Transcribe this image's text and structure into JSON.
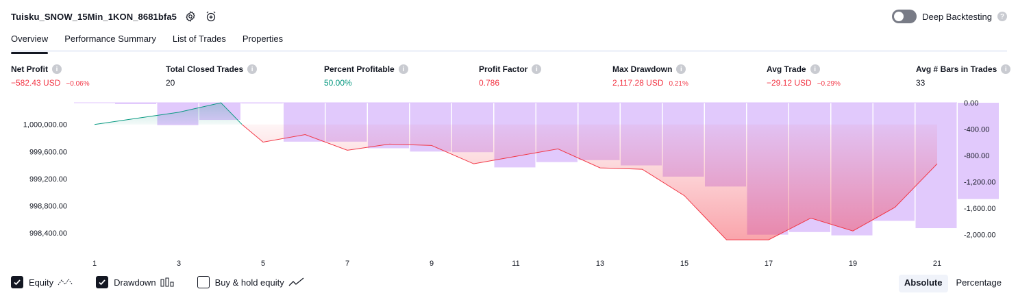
{
  "header": {
    "title": "Tuisku_SNOW_15Min_1KON_8681bfa5",
    "icons": [
      "settings-icon",
      "alarm-add-icon"
    ]
  },
  "deep_backtesting": {
    "label": "Deep Backtesting",
    "enabled": false,
    "help": "?"
  },
  "tabs": [
    {
      "label": "Overview",
      "active": true
    },
    {
      "label": "Performance Summary",
      "active": false
    },
    {
      "label": "List of Trades",
      "active": false
    },
    {
      "label": "Properties",
      "active": false
    }
  ],
  "metrics": {
    "net_profit": {
      "label": "Net Profit",
      "value": "−582.43 USD",
      "pct": "−0.06%"
    },
    "total_closed_trades": {
      "label": "Total Closed Trades",
      "value": "20"
    },
    "percent_profitable": {
      "label": "Percent Profitable",
      "value": "50.00%"
    },
    "profit_factor": {
      "label": "Profit Factor",
      "value": "0.786"
    },
    "max_drawdown": {
      "label": "Max Drawdown",
      "value": "2,117.28 USD",
      "pct": "0.21%"
    },
    "avg_trade": {
      "label": "Avg Trade",
      "value": "−29.12 USD",
      "pct": "−0.29%"
    },
    "avg_bars": {
      "label": "Avg # Bars in Trades",
      "value": "33"
    }
  },
  "colors": {
    "loss": "#f23645",
    "profit": "#089981",
    "drawdown": "#e1c4fc",
    "text": "#131722"
  },
  "chart_data": {
    "type": "line",
    "x_ticks": [
      "1",
      "3",
      "5",
      "7",
      "9",
      "11",
      "13",
      "15",
      "17",
      "19",
      "21"
    ],
    "x": [
      1,
      2,
      3,
      4,
      5,
      6,
      7,
      8,
      9,
      10,
      11,
      12,
      13,
      14,
      15,
      16,
      17,
      18,
      19,
      20,
      21
    ],
    "equity_axis": {
      "ylim": [
        998200,
        1000320
      ],
      "ticks": [
        "1,000,000.00",
        "999,600.00",
        "999,200.00",
        "998,800.00",
        "998,400.00"
      ],
      "tick_values": [
        1000000,
        999600,
        999200,
        998800,
        998400
      ]
    },
    "drawdown_axis": {
      "ylim": [
        -2180,
        0
      ],
      "ticks": [
        "0.00",
        "-400.00",
        "-800.00",
        "-1,200.00",
        "-1,600.00",
        "-2,000.00"
      ],
      "tick_values": [
        0,
        -400,
        -800,
        -1200,
        -1600,
        -2000
      ]
    },
    "series": [
      {
        "name": "Equity",
        "values": [
          1000000,
          1000090,
          1000180,
          1000320,
          999740,
          999850,
          999620,
          999710,
          999690,
          999420,
          999530,
          999640,
          999360,
          999340,
          998950,
          998300,
          998300,
          998620,
          998430,
          998780,
          999420
        ]
      },
      {
        "name": "Drawdown",
        "values": [
          -20,
          -340,
          -260,
          0,
          -590,
          -590,
          -690,
          -740,
          -750,
          -980,
          -900,
          -870,
          -950,
          -1120,
          -1270,
          -2000,
          -1960,
          -2010,
          -1790,
          -1900,
          -1460
        ]
      },
      {
        "name": "Buy & hold equity",
        "values": []
      }
    ]
  },
  "legend": [
    {
      "label": "Equity",
      "checked": true,
      "icon": "equity-line-icon"
    },
    {
      "label": "Drawdown",
      "checked": true,
      "icon": "drawdown-bars-icon"
    },
    {
      "label": "Buy & hold equity",
      "checked": false,
      "icon": "buy-hold-line-icon"
    }
  ],
  "modes": [
    {
      "label": "Absolute",
      "active": true
    },
    {
      "label": "Percentage",
      "active": false
    }
  ]
}
